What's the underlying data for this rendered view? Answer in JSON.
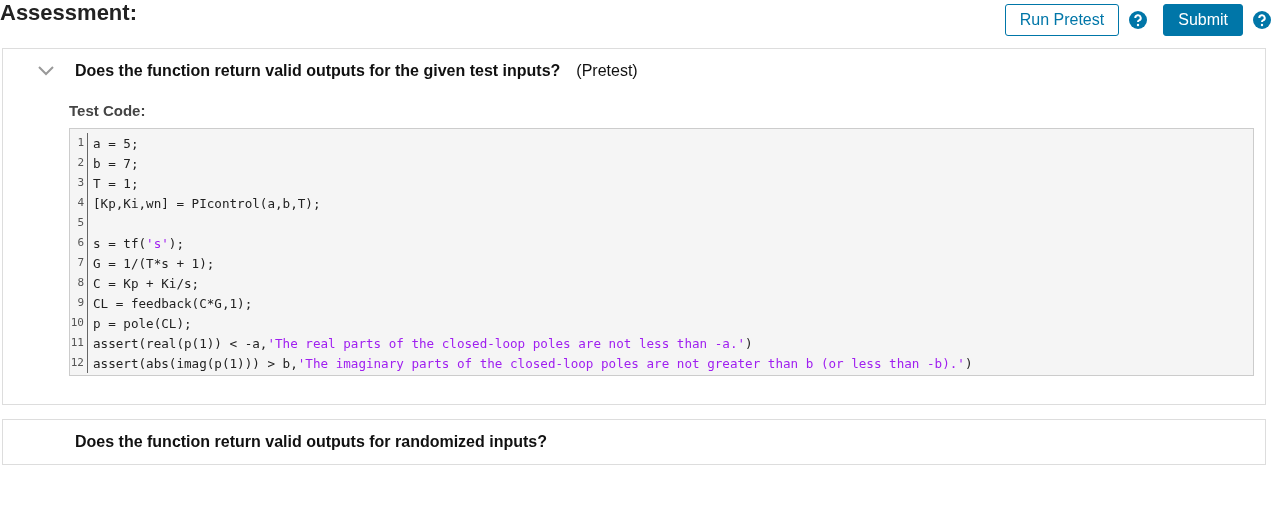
{
  "heading": "Assessment:",
  "buttons": [
    {
      "label": "Run Pretest",
      "kind": "outline"
    },
    {
      "label": "Submit",
      "kind": "primary"
    }
  ],
  "tests": [
    {
      "title": "Does the function return valid outputs for the given test inputs?",
      "tag": "(Pretest)",
      "expanded": true,
      "code_label": "Test Code:",
      "code": [
        {
          "number": "1",
          "parts": [
            {
              "kind": "code",
              "text": "a = 5;"
            }
          ]
        },
        {
          "number": "2",
          "parts": [
            {
              "kind": "code",
              "text": "b = 7;"
            }
          ]
        },
        {
          "number": "3",
          "parts": [
            {
              "kind": "code",
              "text": "T = 1;"
            }
          ]
        },
        {
          "number": "4",
          "parts": [
            {
              "kind": "code",
              "text": "[Kp,Ki,wn] = PIcontrol(a,b,T);"
            }
          ]
        },
        {
          "number": "5"
        },
        {
          "number": "6",
          "parts": [
            {
              "kind": "code",
              "text": "s = tf("
            },
            {
              "kind": "string",
              "text": "'s'"
            },
            {
              "kind": "code",
              "text": ");"
            }
          ]
        },
        {
          "number": "7",
          "parts": [
            {
              "kind": "code",
              "text": "G = 1/(T*s + 1);"
            }
          ]
        },
        {
          "number": "8",
          "parts": [
            {
              "kind": "code",
              "text": "C = Kp + Ki/s;"
            }
          ]
        },
        {
          "number": "9",
          "parts": [
            {
              "kind": "code",
              "text": "CL = feedback(C*G,1);"
            }
          ]
        },
        {
          "number": "10",
          "parts": [
            {
              "kind": "code",
              "text": "p = pole(CL);"
            }
          ]
        },
        {
          "number": "11",
          "parts": [
            {
              "kind": "code",
              "text": "assert(real(p(1)) < -a,"
            },
            {
              "kind": "string",
              "text": "'The real parts of the closed-loop poles are not less than -a.'"
            },
            {
              "kind": "code",
              "text": ")"
            }
          ]
        },
        {
          "number": "12",
          "parts": [
            {
              "kind": "code",
              "text": "assert(abs(imag(p(1))) > b,"
            },
            {
              "kind": "string",
              "text": "'The imaginary parts of the closed-loop poles are not greater than b (or less than -b).'"
            },
            {
              "kind": "code",
              "text": ")"
            }
          ]
        }
      ]
    },
    {
      "title": "Does the function return valid outputs for randomized inputs?",
      "expanded": false
    }
  ]
}
